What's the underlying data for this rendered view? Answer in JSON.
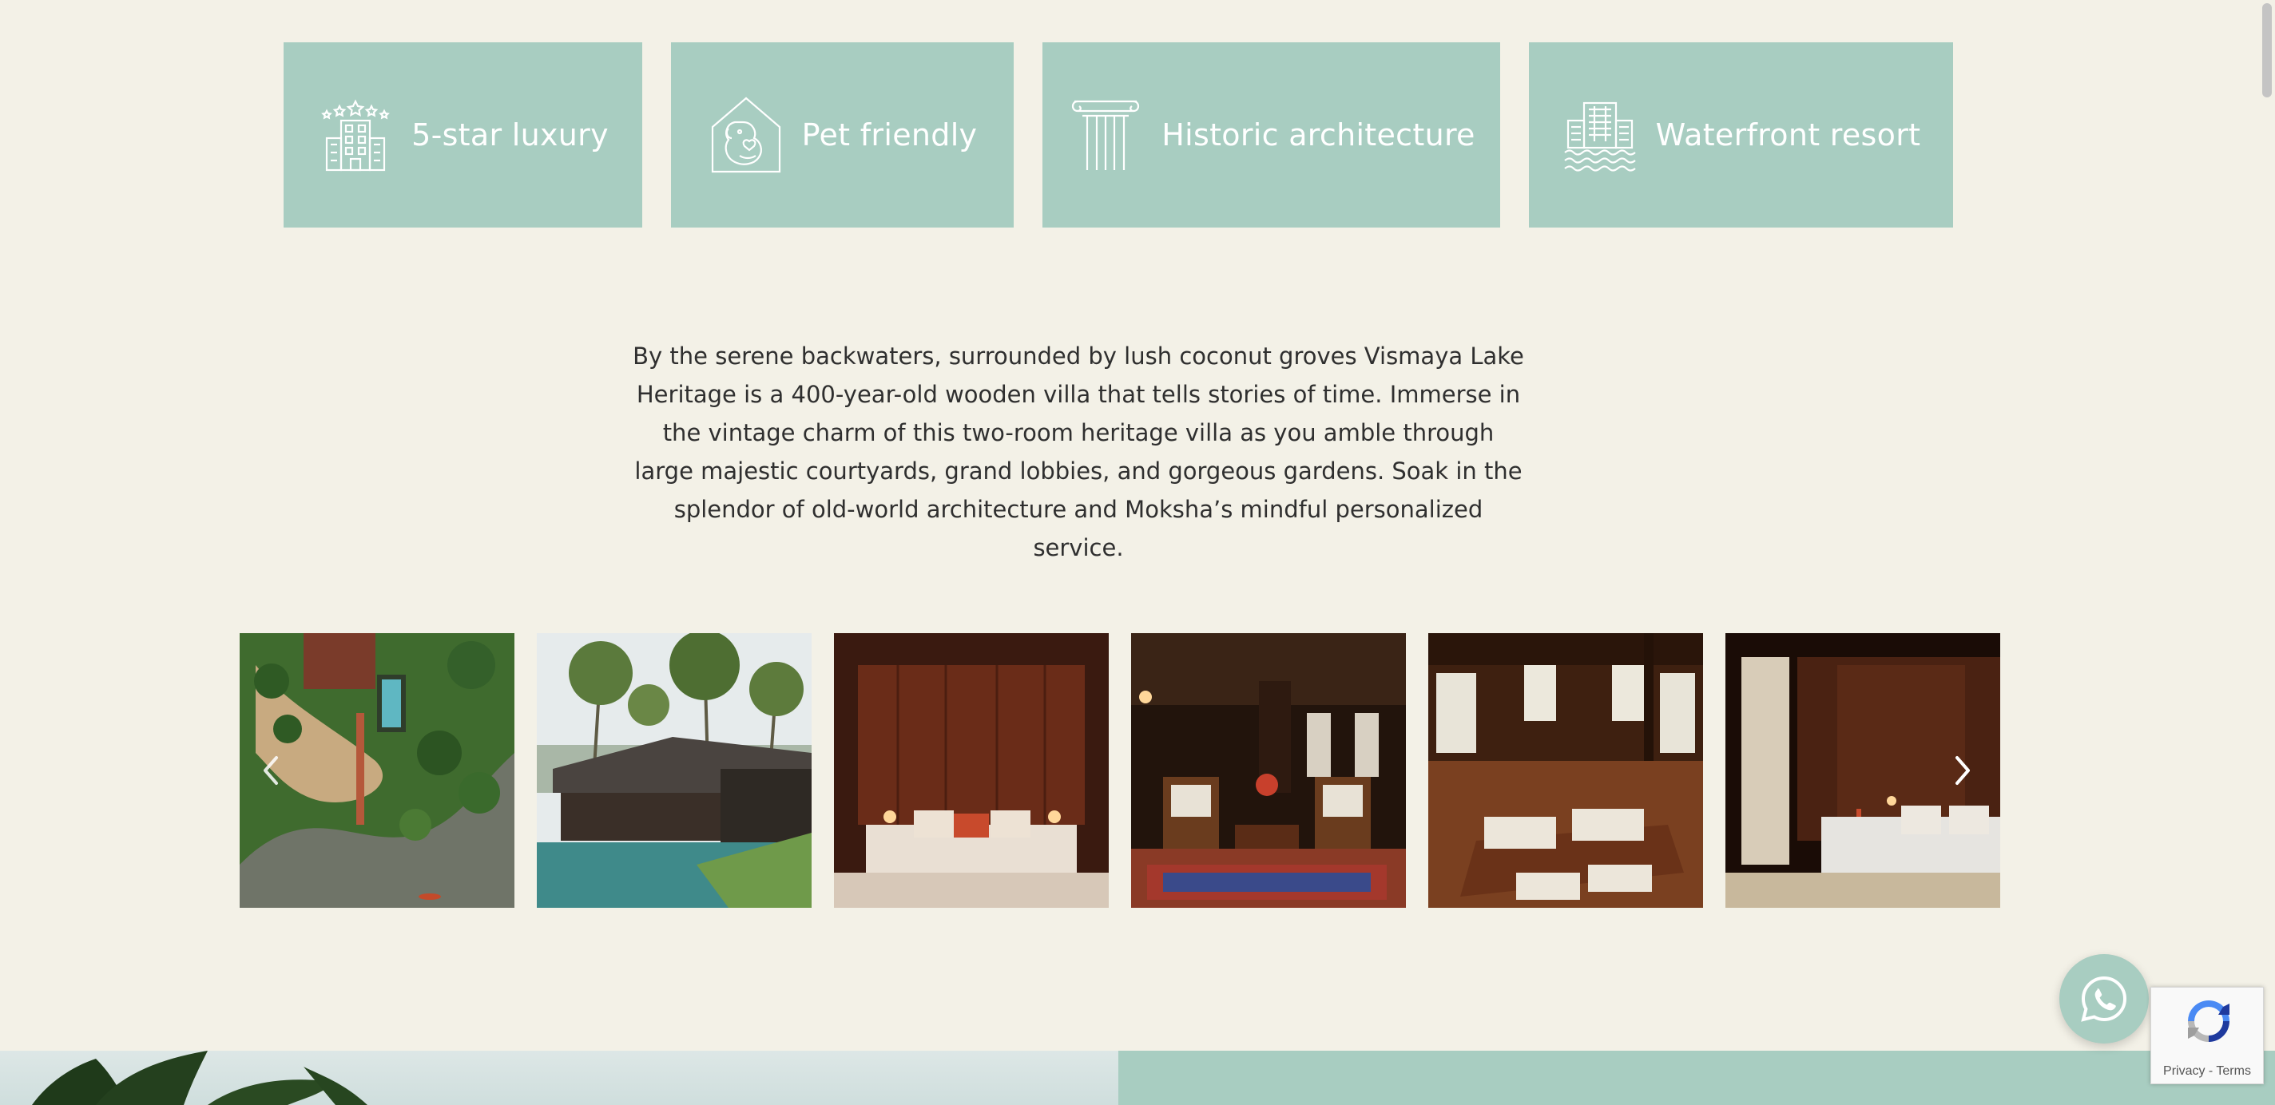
{
  "features": [
    {
      "label": "5-star luxury",
      "icon": "hotel-stars-icon"
    },
    {
      "label": "Pet friendly",
      "icon": "pet-house-icon"
    },
    {
      "label": "Historic architecture",
      "icon": "column-icon"
    },
    {
      "label": "Waterfront resort",
      "icon": "waterfront-building-icon"
    }
  ],
  "description": "By the serene backwaters, surrounded by lush coconut groves Vismaya Lake Heritage is a 400-year-old wooden villa that tells stories of time. Immerse in the vintage charm of this two-room heritage villa as you amble through large majestic courtyards, grand lobbies, and gorgeous gardens. Soak in the splendor of old-world architecture and Moksha’s mindful personalized service.",
  "gallery": {
    "photos": [
      "aerial-resort-photo",
      "pool-pavilion-photo",
      "wooden-bedroom-photo",
      "sitting-room-photo",
      "swing-bed-photo",
      "bedroom-curtains-photo"
    ],
    "prev_icon": "chevron-left-icon",
    "next_icon": "chevron-right-icon"
  },
  "recaptcha": {
    "privacy": "Privacy",
    "separator": " - ",
    "terms": "Terms"
  },
  "whatsapp_icon": "whatsapp-icon",
  "colors": {
    "background": "#f3f1e7",
    "accent": "#a8cdc1",
    "text": "#2f2f2f"
  }
}
